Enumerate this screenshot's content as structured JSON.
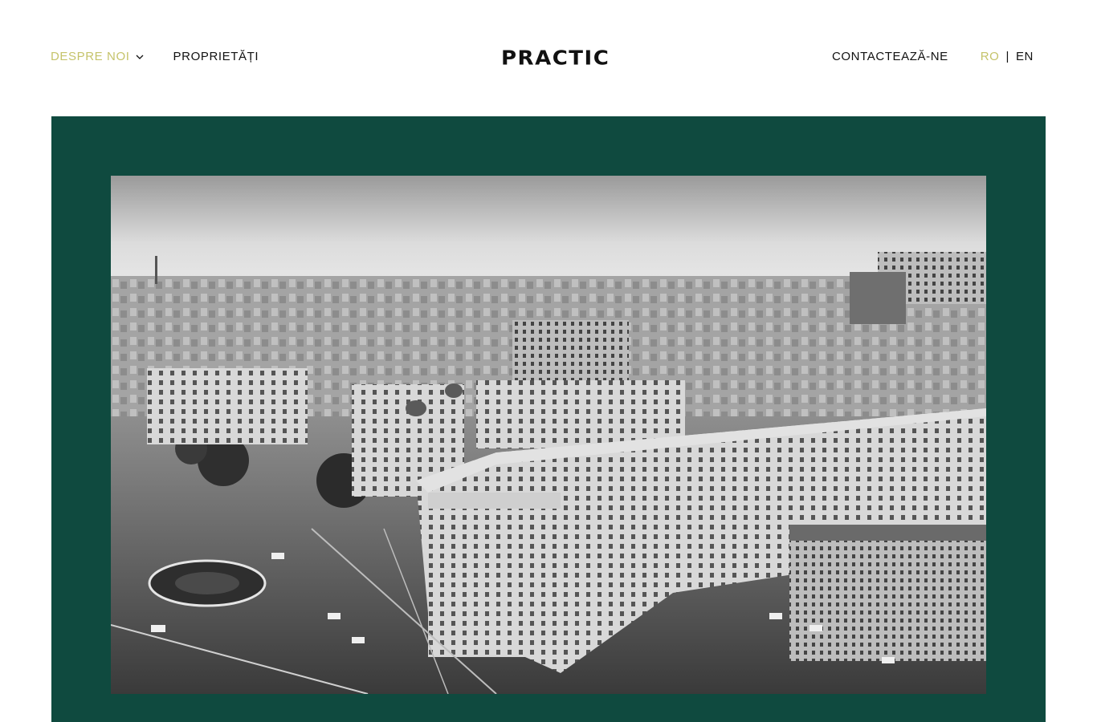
{
  "header": {
    "nav_left": [
      {
        "label": "DESPRE NOI",
        "active": true,
        "has_dropdown": true
      },
      {
        "label": "PROPRIETĂȚI",
        "active": false,
        "has_dropdown": false
      }
    ],
    "logo": "PRACTIC",
    "contact_label": "CONTACTEAZĂ-NE",
    "languages": {
      "current": "RO",
      "separator": "|",
      "other": "EN"
    }
  },
  "hero": {
    "image_description_icon": "city-aerial-photo",
    "background_color": "#0f4a3f"
  },
  "colors": {
    "accent": "#c5c36a",
    "text": "#111111",
    "hero_bg": "#0f4a3f"
  }
}
